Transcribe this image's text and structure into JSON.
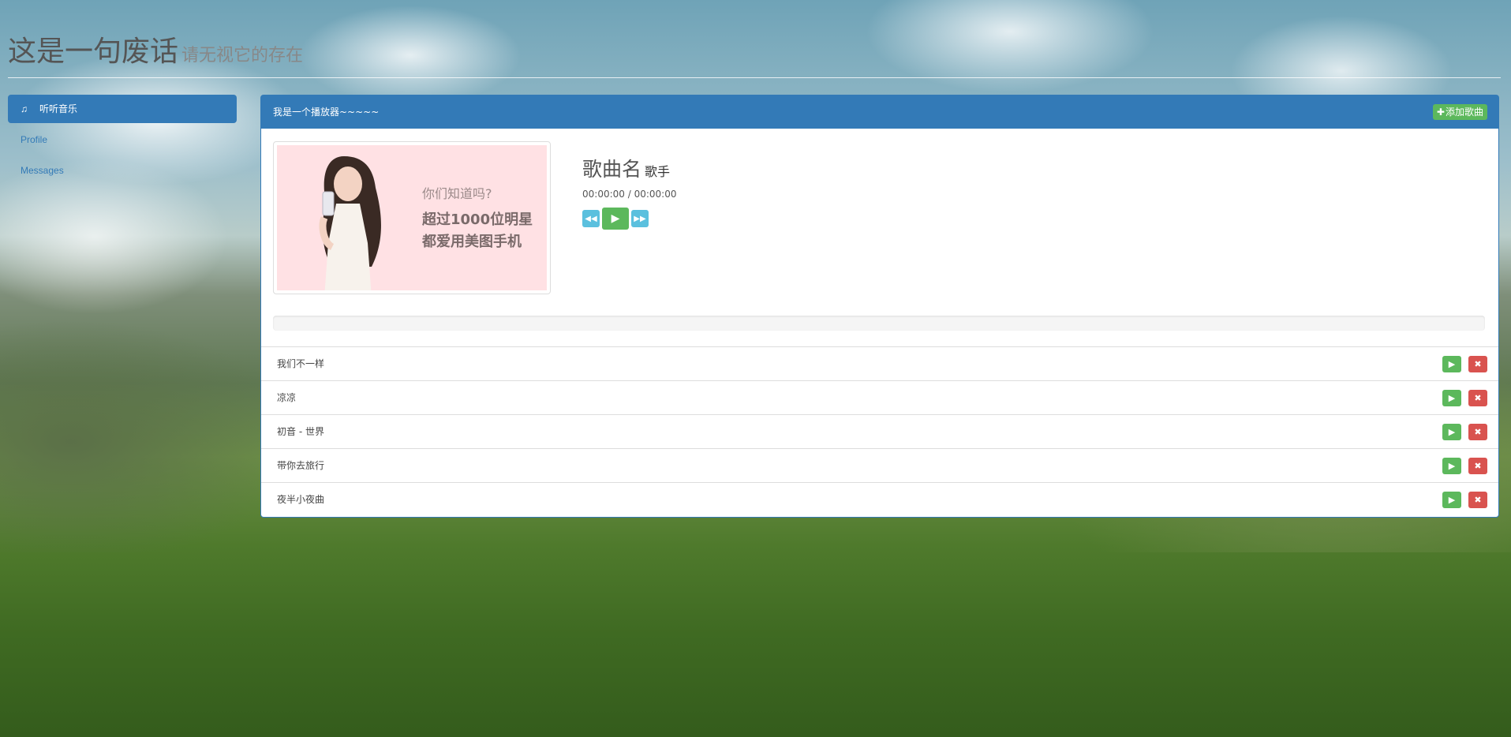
{
  "header": {
    "title": "这是一句废话",
    "subtitle": "请无视它的存在"
  },
  "sidebar": {
    "items": [
      {
        "label": "听听音乐",
        "icon": "music-icon",
        "active": true
      },
      {
        "label": "Profile",
        "active": false
      },
      {
        "label": "Messages",
        "active": false
      }
    ]
  },
  "panel": {
    "title": "我是一个播放器~~~~~",
    "add_label": "添加歌曲"
  },
  "cover": {
    "line1": "你们知道吗?",
    "line2": "超过1000位明星",
    "line3": "都爱用美图手机"
  },
  "player": {
    "song_name": "歌曲名",
    "artist": "歌手",
    "time": "00:00:00 / 00:00:00",
    "progress": 0
  },
  "playlist": [
    {
      "name": "我们不一样"
    },
    {
      "name": "凉凉"
    },
    {
      "name": "初音 - 世界"
    },
    {
      "name": "带你去旅行"
    },
    {
      "name": "夜半小夜曲"
    }
  ],
  "colors": {
    "primary": "#337ab7",
    "success": "#5cb85c",
    "info": "#5bc0de",
    "danger": "#d9534f"
  }
}
